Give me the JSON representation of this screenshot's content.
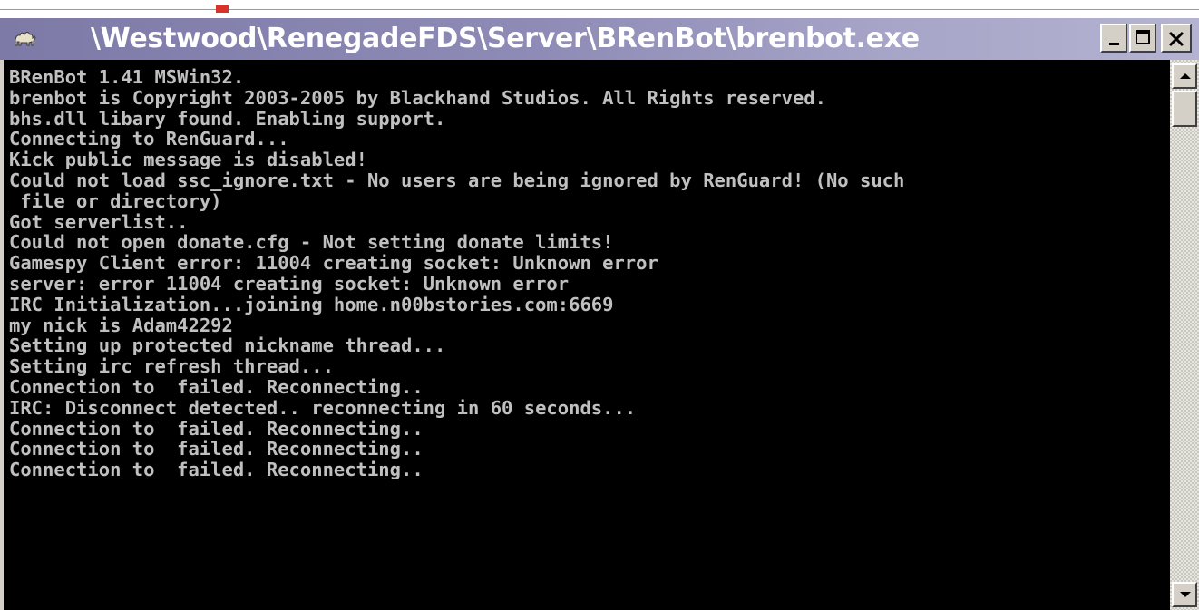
{
  "window": {
    "title": "\\Westwood\\RenegadeFDS\\Server\\BRenBot\\brenbot.exe",
    "icon": "camel-icon",
    "buttons": {
      "minimize_icon": "minimize-icon",
      "maximize_icon": "maximize-icon",
      "close_icon": "close-icon"
    }
  },
  "console": {
    "text_color": "#c0c0c0",
    "background_color": "#000000",
    "lines": [
      "BRenBot 1.41 MSWin32.",
      "brenbot is Copyright 2003-2005 by Blackhand Studios. All Rights reserved.",
      "bhs.dll libary found. Enabling support.",
      "Connecting to RenGuard...",
      "Kick public message is disabled!",
      "Could not load ssc_ignore.txt - No users are being ignored by RenGuard! (No such",
      " file or directory)",
      "Got serverlist..",
      "Could not open donate.cfg - Not setting donate limits!",
      "Gamespy Client error: 11004 creating socket: Unknown error",
      "server: error 11004 creating socket: Unknown error",
      "IRC Initialization...joining home.n00bstories.com:6669",
      "my nick is Adam42292",
      "Setting up protected nickname thread...",
      "Setting irc refresh thread...",
      "Connection to  failed. Reconnecting..",
      "IRC: Disconnect detected.. reconnecting in 60 seconds...",
      "Connection to  failed. Reconnecting..",
      "Connection to  failed. Reconnecting..",
      "Connection to  failed. Reconnecting.."
    ]
  },
  "scrollbar": {
    "up_icon": "scroll-up-arrow-icon",
    "down_icon": "scroll-down-arrow-icon"
  }
}
